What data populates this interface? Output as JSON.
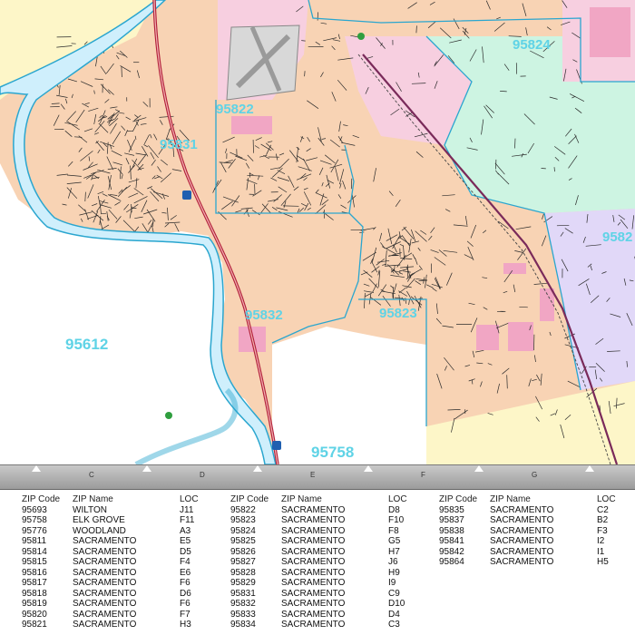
{
  "map": {
    "zip_labels": [
      "95824",
      "95822",
      "95831",
      "95612",
      "95832",
      "95823",
      "95758",
      "9582"
    ],
    "colors": {
      "water": "#cfeffc",
      "river_edge": "#2aa6cf",
      "peach": "#f8d3b4",
      "pink": "#f7cfe0",
      "mint": "#cdf4e2",
      "lavender": "#e1d8f8",
      "yellow": "#fdf6c8",
      "white": "#ffffff",
      "highway": "#b2203a",
      "street": "#2a2a2a"
    }
  },
  "ruler": {
    "letters": [
      "C",
      "D",
      "E",
      "F",
      "G"
    ]
  },
  "index": {
    "header": {
      "zip": "ZIP Code",
      "name": "ZIP Name",
      "loc": "LOC"
    },
    "columns": [
      [
        {
          "zip": "95693",
          "name": "WILTON",
          "loc": "J11"
        },
        {
          "zip": "95758",
          "name": "ELK GROVE",
          "loc": "F11"
        },
        {
          "zip": "95776",
          "name": "WOODLAND",
          "loc": "A3"
        },
        {
          "zip": "95811",
          "name": "SACRAMENTO",
          "loc": "E5"
        },
        {
          "zip": "95814",
          "name": "SACRAMENTO",
          "loc": "D5"
        },
        {
          "zip": "95815",
          "name": "SACRAMENTO",
          "loc": "F4"
        },
        {
          "zip": "95816",
          "name": "SACRAMENTO",
          "loc": "E6"
        },
        {
          "zip": "95817",
          "name": "SACRAMENTO",
          "loc": "F6"
        },
        {
          "zip": "95818",
          "name": "SACRAMENTO",
          "loc": "D6"
        },
        {
          "zip": "95819",
          "name": "SACRAMENTO",
          "loc": "F6"
        },
        {
          "zip": "95820",
          "name": "SACRAMENTO",
          "loc": "F7"
        },
        {
          "zip": "95821",
          "name": "SACRAMENTO",
          "loc": "H3"
        }
      ],
      [
        {
          "zip": "95822",
          "name": "SACRAMENTO",
          "loc": "D8"
        },
        {
          "zip": "95823",
          "name": "SACRAMENTO",
          "loc": "F10"
        },
        {
          "zip": "95824",
          "name": "SACRAMENTO",
          "loc": "F8"
        },
        {
          "zip": "95825",
          "name": "SACRAMENTO",
          "loc": "G5"
        },
        {
          "zip": "95826",
          "name": "SACRAMENTO",
          "loc": "H7"
        },
        {
          "zip": "95827",
          "name": "SACRAMENTO",
          "loc": "J6"
        },
        {
          "zip": "95828",
          "name": "SACRAMENTO",
          "loc": "H9"
        },
        {
          "zip": "95829",
          "name": "SACRAMENTO",
          "loc": "I9"
        },
        {
          "zip": "95831",
          "name": "SACRAMENTO",
          "loc": "C9"
        },
        {
          "zip": "95832",
          "name": "SACRAMENTO",
          "loc": "D10"
        },
        {
          "zip": "95833",
          "name": "SACRAMENTO",
          "loc": "D4"
        },
        {
          "zip": "95834",
          "name": "SACRAMENTO",
          "loc": "C3"
        }
      ],
      [
        {
          "zip": "95835",
          "name": "SACRAMENTO",
          "loc": "C2"
        },
        {
          "zip": "95837",
          "name": "SACRAMENTO",
          "loc": "B2"
        },
        {
          "zip": "95838",
          "name": "SACRAMENTO",
          "loc": "F3"
        },
        {
          "zip": "95841",
          "name": "SACRAMENTO",
          "loc": "I2"
        },
        {
          "zip": "95842",
          "name": "SACRAMENTO",
          "loc": "I1"
        },
        {
          "zip": "95864",
          "name": "SACRAMENTO",
          "loc": "H5"
        }
      ]
    ]
  }
}
